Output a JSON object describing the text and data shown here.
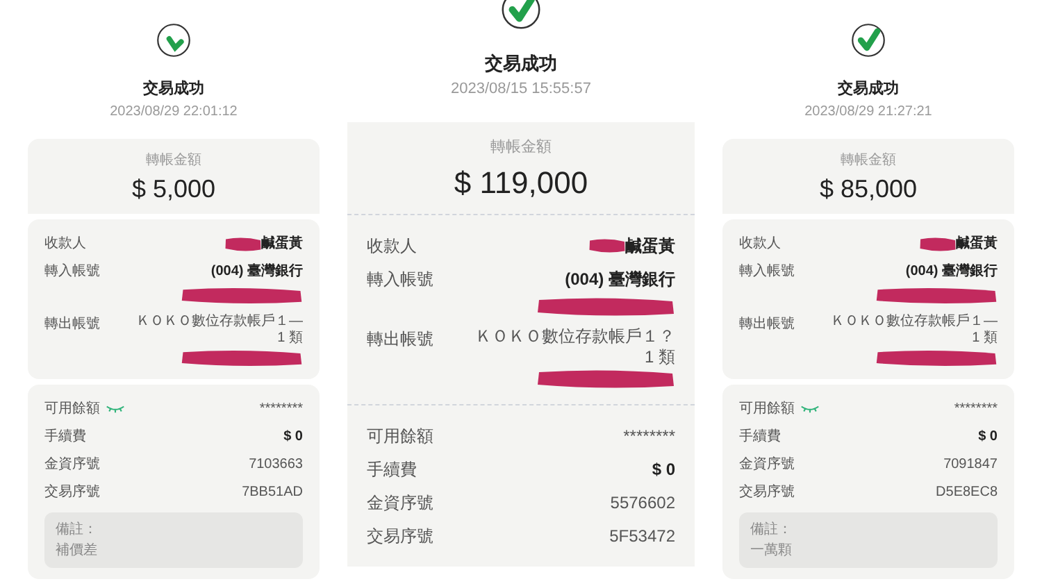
{
  "receipts": [
    {
      "status_icon": {
        "kind": "partial"
      },
      "status": "交易成功",
      "datetime": "2023/08/29 22:01:12",
      "amount_label": "轉帳金額",
      "amount": "$ 5,000",
      "payee": {
        "label": "收款人",
        "value": "鹹蛋黃"
      },
      "to_account": {
        "label": "轉入帳號",
        "value": "(004) 臺灣銀行"
      },
      "from_account": {
        "label": "轉出帳號",
        "value": "ＫＯＫＯ數位存款帳戶１—",
        "value_line_2": "1 類"
      },
      "balance": {
        "label": "可用餘額",
        "value": "********",
        "toggle_icon": {
          "kind": "closed_eye"
        }
      },
      "rows": [
        {
          "kind": "fee",
          "label": "手續費",
          "value": "$ 0"
        },
        {
          "kind": "serial",
          "label": "金資序號",
          "value": "7103663"
        },
        {
          "kind": "serial",
          "label": "交易序號",
          "value": "7BB51AD"
        }
      ],
      "note": {
        "label": "備註：",
        "text": "補價差"
      }
    },
    {
      "status_icon": {
        "kind": "full"
      },
      "status": "交易成功",
      "datetime": "2023/08/15 15:55:57",
      "amount_label": "轉帳金額",
      "amount": "$ 119,000",
      "payee": {
        "label": "收款人",
        "value": "鹹蛋黃"
      },
      "to_account": {
        "label": "轉入帳號",
        "value": "(004) 臺灣銀行"
      },
      "from_account": {
        "label": "轉出帳號",
        "value": "ＫＯＫＯ數位存款帳戶１？",
        "value_line_2": "1 類"
      },
      "balance": {
        "label": "可用餘額",
        "value": "********"
      },
      "rows": [
        {
          "kind": "fee",
          "label": "手續費",
          "value": "$ 0"
        },
        {
          "kind": "serial",
          "label": "金資序號",
          "value": "5576602"
        },
        {
          "kind": "serial",
          "label": "交易序號",
          "value": "5F53472"
        }
      ]
    },
    {
      "status_icon": {
        "kind": "full"
      },
      "status": "交易成功",
      "datetime": "2023/08/29 21:27:21",
      "amount_label": "轉帳金額",
      "amount": "$ 85,000",
      "payee": {
        "label": "收款人",
        "value": "鹹蛋黃"
      },
      "to_account": {
        "label": "轉入帳號",
        "value": "(004) 臺灣銀行"
      },
      "from_account": {
        "label": "轉出帳號",
        "value": "ＫＯＫＯ數位存款帳戶１—",
        "value_line_2": "1 類"
      },
      "balance": {
        "label": "可用餘額",
        "value": "********",
        "toggle_icon": {
          "kind": "closed_eye"
        }
      },
      "rows": [
        {
          "kind": "fee",
          "label": "手續費",
          "value": "$ 0"
        },
        {
          "kind": "serial",
          "label": "金資序號",
          "value": "7091847"
        },
        {
          "kind": "serial",
          "label": "交易序號",
          "value": "D5E8EC8"
        }
      ],
      "note": {
        "label": "備註：",
        "text": "一萬顆"
      }
    }
  ]
}
